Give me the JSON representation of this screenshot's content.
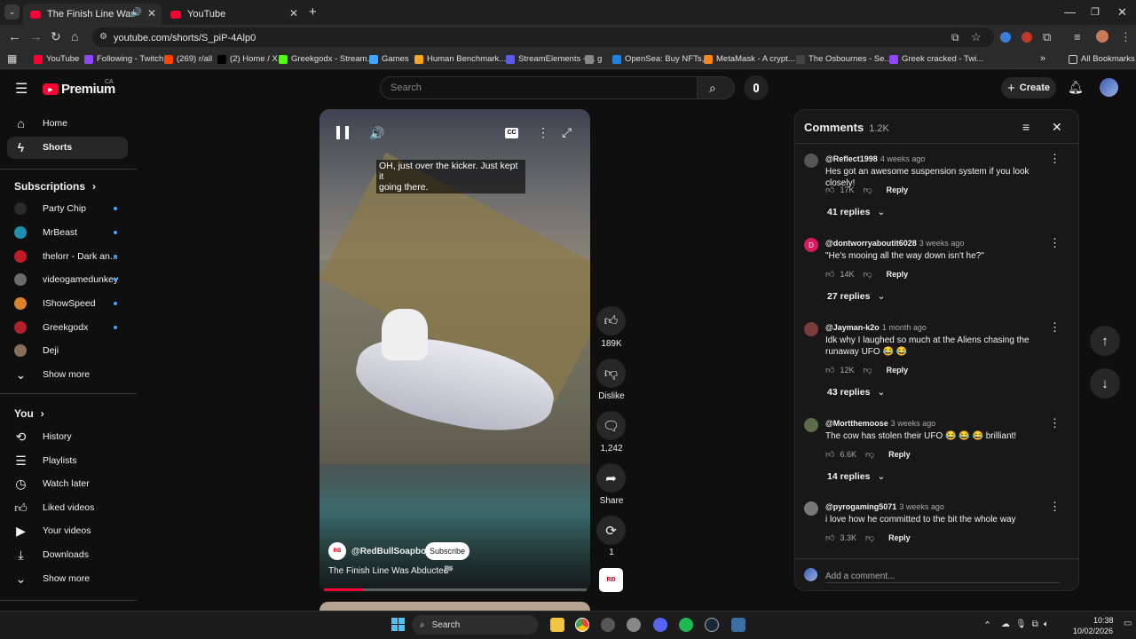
{
  "browser": {
    "tabs": [
      {
        "title": "The Finish Line Was Abducted"
      },
      {
        "title": "YouTube"
      }
    ],
    "new_tab": "+",
    "url": "youtube.com/shorts/S_piP-4Alp0",
    "bookmarks": [
      {
        "label": "YouTube",
        "color": "#ff0033"
      },
      {
        "label": "Following - Twitch",
        "color": "#9146ff"
      },
      {
        "label": "(269) r/all",
        "color": "#ff4500"
      },
      {
        "label": "(2) Home / X",
        "color": "#000000"
      },
      {
        "label": "Greekgodx - Stream...",
        "color": "#53fc18"
      },
      {
        "label": "Games",
        "color": "#3ea6ff"
      },
      {
        "label": "Human Benchmark...",
        "color": "#f5a623"
      },
      {
        "label": "StreamElements - ...",
        "color": "#5b5bf0"
      },
      {
        "label": "g",
        "color": "#888888"
      },
      {
        "label": "OpenSea: Buy NFTs,...",
        "color": "#2081e2"
      },
      {
        "label": "MetaMask - A crypt...",
        "color": "#f6851b"
      },
      {
        "label": "The Osbournes - Se...",
        "color": "#444444"
      },
      {
        "label": "Greek cracked - Twi...",
        "color": "#9146ff"
      }
    ],
    "all_bookmarks": "All Bookmarks"
  },
  "youtube": {
    "logo_text": "Premium",
    "country": "CA",
    "search_placeholder": "Search",
    "create_label": "Create",
    "sidebar": {
      "main": [
        {
          "label": "Home",
          "icon": "home-icon"
        },
        {
          "label": "Shorts",
          "icon": "shorts-icon"
        }
      ],
      "subscriptions_title": "Subscriptions",
      "subscriptions": [
        {
          "label": "Party Chip",
          "color": "#2a2a2a"
        },
        {
          "label": "MrBeast",
          "color": "#1f8fb0"
        },
        {
          "label": "thelorr - Dark an...",
          "color": "#c01c28"
        },
        {
          "label": "videogamedunkey",
          "color": "#6b6b6b"
        },
        {
          "label": "IShowSpeed",
          "color": "#d9822b"
        },
        {
          "label": "Greekgodx",
          "color": "#b02030"
        },
        {
          "label": "Deji",
          "color": "#8a6d5a"
        }
      ],
      "show_more": "Show more",
      "you_title": "You",
      "you_items": [
        {
          "label": "History",
          "icon": "history-icon"
        },
        {
          "label": "Playlists",
          "icon": "playlists-icon"
        },
        {
          "label": "Watch later",
          "icon": "watch-later-icon"
        },
        {
          "label": "Liked videos",
          "icon": "like-icon"
        },
        {
          "label": "Your videos",
          "icon": "your-videos-icon"
        },
        {
          "label": "Downloads",
          "icon": "download-icon"
        }
      ],
      "show_more_2": "Show more"
    },
    "short": {
      "caption_line1": "OH, just over the kicker. Just kept it",
      "caption_line2": "going there.",
      "channel": "@RedBullSoapbox",
      "subscribe": "Subscribe",
      "title": "The Finish Line Was Abducted",
      "progress": 0.15,
      "cc": "CC"
    },
    "actions": {
      "likes": "189K",
      "dislike": "Dislike",
      "comments": "1,242",
      "share": "Share",
      "remix": "1"
    },
    "comments_panel": {
      "title": "Comments",
      "count": "1.2K",
      "items": [
        {
          "author": "@Reflect1998",
          "time": "4 weeks ago",
          "text": "Hes got an awesome suspension system  if you look closely!",
          "likes": "17K",
          "replies": "41 replies",
          "avatar_color": "#555555"
        },
        {
          "author": "@dontworryaboutit6028",
          "time": "3 weeks ago",
          "text": "\"He's mooing all the way down isn't he?\"",
          "likes": "14K",
          "replies": "27 replies",
          "avatar_color": "#d81b60",
          "initial": "D"
        },
        {
          "author": "@Jayman-k2o",
          "time": "1 month ago",
          "text": "Idk why I laughed so much at the Aliens chasing the runaway UFO 😂 😂",
          "likes": "12K",
          "replies": "43 replies",
          "avatar_color": "#7a3b3b"
        },
        {
          "author": "@Mortthemoose",
          "time": "3 weeks ago",
          "text": "The cow has stolen their UFO 😂 😂 😂 brilliant!",
          "likes": "6.6K",
          "replies": "14 replies",
          "avatar_color": "#5c6b4a"
        },
        {
          "author": "@pyrogaming5071",
          "time": "3 weeks ago",
          "text": "i love how he committed to the bit the whole way",
          "likes": "3.3K",
          "avatar_color": "#777777"
        }
      ],
      "reply_label": "Reply",
      "add_comment_placeholder": "Add a comment..."
    }
  },
  "taskbar": {
    "search": "Search",
    "time": "10:38",
    "date": "10/02/2026"
  }
}
